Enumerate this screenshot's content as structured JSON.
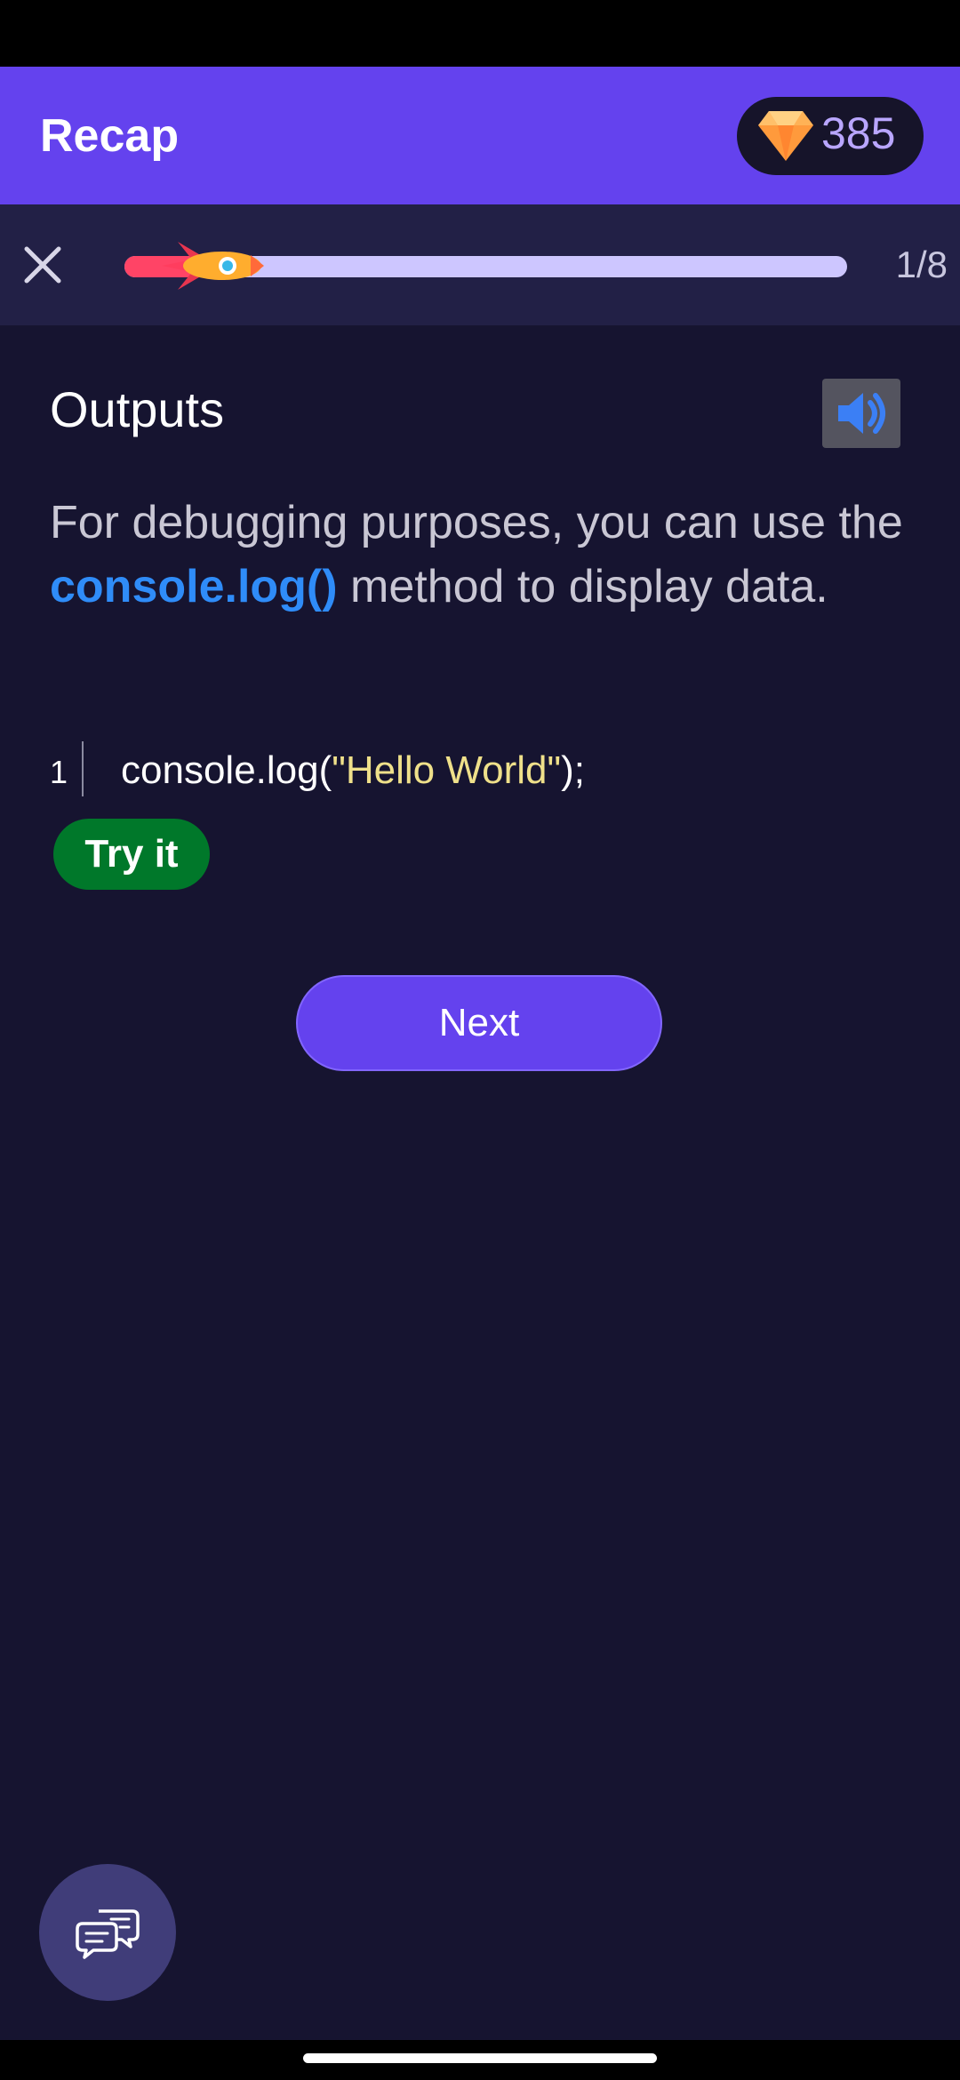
{
  "app_bar": {
    "title": "Recap",
    "gem_count": "385"
  },
  "progress": {
    "current": 1,
    "total": 8,
    "label": "1/8",
    "fill_fraction": 0.125
  },
  "lesson": {
    "title": "Outputs",
    "paragraph_before": "For debugging purposes, you can use the ",
    "inline_code": "console.log()",
    "paragraph_after": " method to display data.",
    "code": {
      "line_number": "1",
      "prefix": "console.log(",
      "string": "\"Hello World\"",
      "suffix": ");"
    },
    "try_it_label": "Try it"
  },
  "actions": {
    "next_label": "Next"
  },
  "icons": {
    "gem": "gem-icon",
    "close": "close-icon",
    "rocket": "rocket-icon",
    "audio": "speaker-icon",
    "chat": "chat-bubbles-icon"
  },
  "colors": {
    "accent": "#6442ee",
    "background": "#161430",
    "link_code": "#2f8cf8",
    "string_code": "#efe08a",
    "try_it": "#00782a",
    "progress_track": "#cdc6ff",
    "progress_fill": "#ff4466"
  }
}
